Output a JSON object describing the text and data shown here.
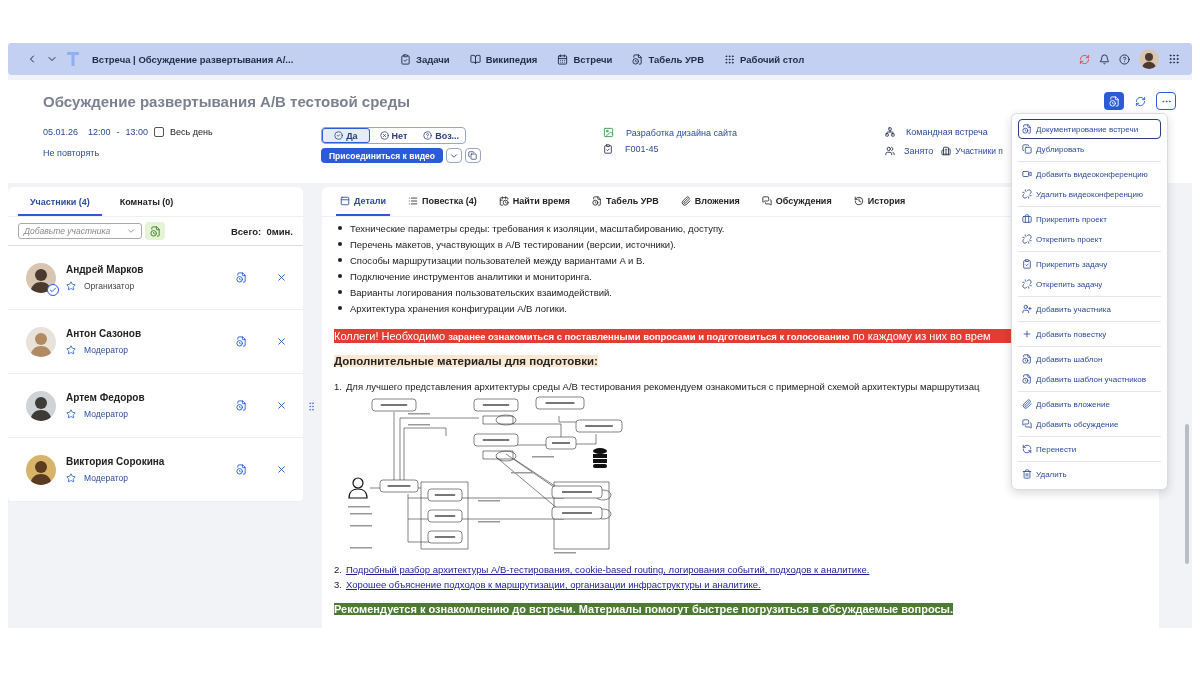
{
  "top_bar": {
    "title": "Встреча | Обсуждение развертывания A/...",
    "nav": [
      "Задачи",
      "Википедия",
      "Встречи",
      "Табель УРВ",
      "Рабочий стол"
    ]
  },
  "meeting": {
    "title": "Обсуждение развертывания A/B тестовой среды",
    "date": "05.01.26",
    "start": "12:00",
    "dash": "-",
    "end": "13:00",
    "all_day": {
      "label": "Весь день",
      "checked": false
    },
    "repeat": "Не повторять",
    "rsvp": [
      {
        "label": "Да",
        "selected": true
      },
      {
        "label": "Нет",
        "selected": false
      },
      {
        "label": "Воз...",
        "selected": false
      }
    ],
    "join_button": "Присоединиться к видео",
    "project": "Разработка дизайна сайта",
    "task": "F001-45",
    "type": "Командная встреча",
    "busy": "Занято",
    "participants_link": "Участники п"
  },
  "left_tabs": [
    {
      "label": "Участники (4)",
      "selected": true
    },
    {
      "label": "Комнаты (0)",
      "selected": false
    }
  ],
  "participant_select": {
    "placeholder": "Добавьте участника"
  },
  "total": "Всего:  0мин.",
  "participants": [
    {
      "name": "Андрей Марков",
      "role": "Организатор",
      "kind": "organizer",
      "accepted": true
    },
    {
      "name": "Антон Сазонов",
      "role": "Модератор",
      "kind": "moderator",
      "accepted": false
    },
    {
      "name": "Артем Федоров",
      "role": "Модератор",
      "kind": "moderator",
      "accepted": false
    },
    {
      "name": "Виктория Сорокина",
      "role": "Модератор",
      "kind": "moderator",
      "accepted": false
    }
  ],
  "tabs": [
    {
      "label": "Детали",
      "selected": true
    },
    {
      "label": "Повестка (4)",
      "selected": false
    },
    {
      "label": "Найти время",
      "selected": false
    },
    {
      "label": "Табель УРВ",
      "selected": false
    },
    {
      "label": "Вложения",
      "selected": false
    },
    {
      "label": "Обсуждения",
      "selected": false
    },
    {
      "label": "История",
      "selected": false
    }
  ],
  "bullets": [
    "Технические параметры среды: требования к изоляции, масштабированию, доступу.",
    "Перечень макетов, участвующих в A/B тестировании (версии, источники).",
    "Способы маршрутизации пользователей между вариантами A и B.",
    "Подключение инструментов аналитики и мониторинга.",
    "Варианты логирования пользовательских взаимодействий.",
    "Архитектура хранения конфигурации A/B логики."
  ],
  "alert": "Коллеги! Необходимо **заранее ознакомиться с поставленными вопросами и подготовиться к голосованию** по каждому из них во врем",
  "materials_heading": "Дополнительные материалы для подготовки:",
  "materials": [
    {
      "number": "1.",
      "text": "Для лучшего представления архитектуры среды A/B тестирования рекомендуем ознакомиться с примерной схемой архитектуры маршрутизац",
      "kind": "text"
    },
    {
      "number": "2.",
      "text": "Подробный разбор архитектуры A/B-тестирования, cookie-based routing, логирования событий, подходов к аналитике.",
      "kind": "link"
    },
    {
      "number": "3.",
      "text": "Хорошее объяснение подходов к маршрутизации, организации инфраструктуры и аналитике.",
      "kind": "link"
    }
  ],
  "recommendation": "Рекомендуется к ознакомлению до встречи. Материалы помогут быстрее погрузиться в обсуждаемые вопросы.",
  "menu": [
    [
      {
        "label": "Документирование встречи",
        "focused": true
      },
      {
        "label": "Дублировать",
        "focused": false
      }
    ],
    [
      {
        "label": "Добавить видеоконференцию",
        "focused": false
      },
      {
        "label": "Удалить видеоконференцию",
        "focused": false
      }
    ],
    [
      {
        "label": "Прикрепить проект",
        "focused": false
      },
      {
        "label": "Открепить проект",
        "focused": false
      }
    ],
    [
      {
        "label": "Прикрепить задачу",
        "focused": false
      },
      {
        "label": "Открепить задачу",
        "focused": false
      }
    ],
    [
      {
        "label": "Добавить участника",
        "focused": false
      }
    ],
    [
      {
        "label": "Добавить повестку",
        "focused": false
      }
    ],
    [
      {
        "label": "Добавить шаблон",
        "focused": false
      },
      {
        "label": "Добавить шаблон участников",
        "focused": false
      }
    ],
    [
      {
        "label": "Добавить вложение",
        "focused": false
      },
      {
        "label": "Добавить обсуждение",
        "focused": false
      }
    ],
    [
      {
        "label": "Перенести",
        "focused": false
      }
    ],
    [
      {
        "label": "Удалить",
        "focused": false
      }
    ]
  ]
}
